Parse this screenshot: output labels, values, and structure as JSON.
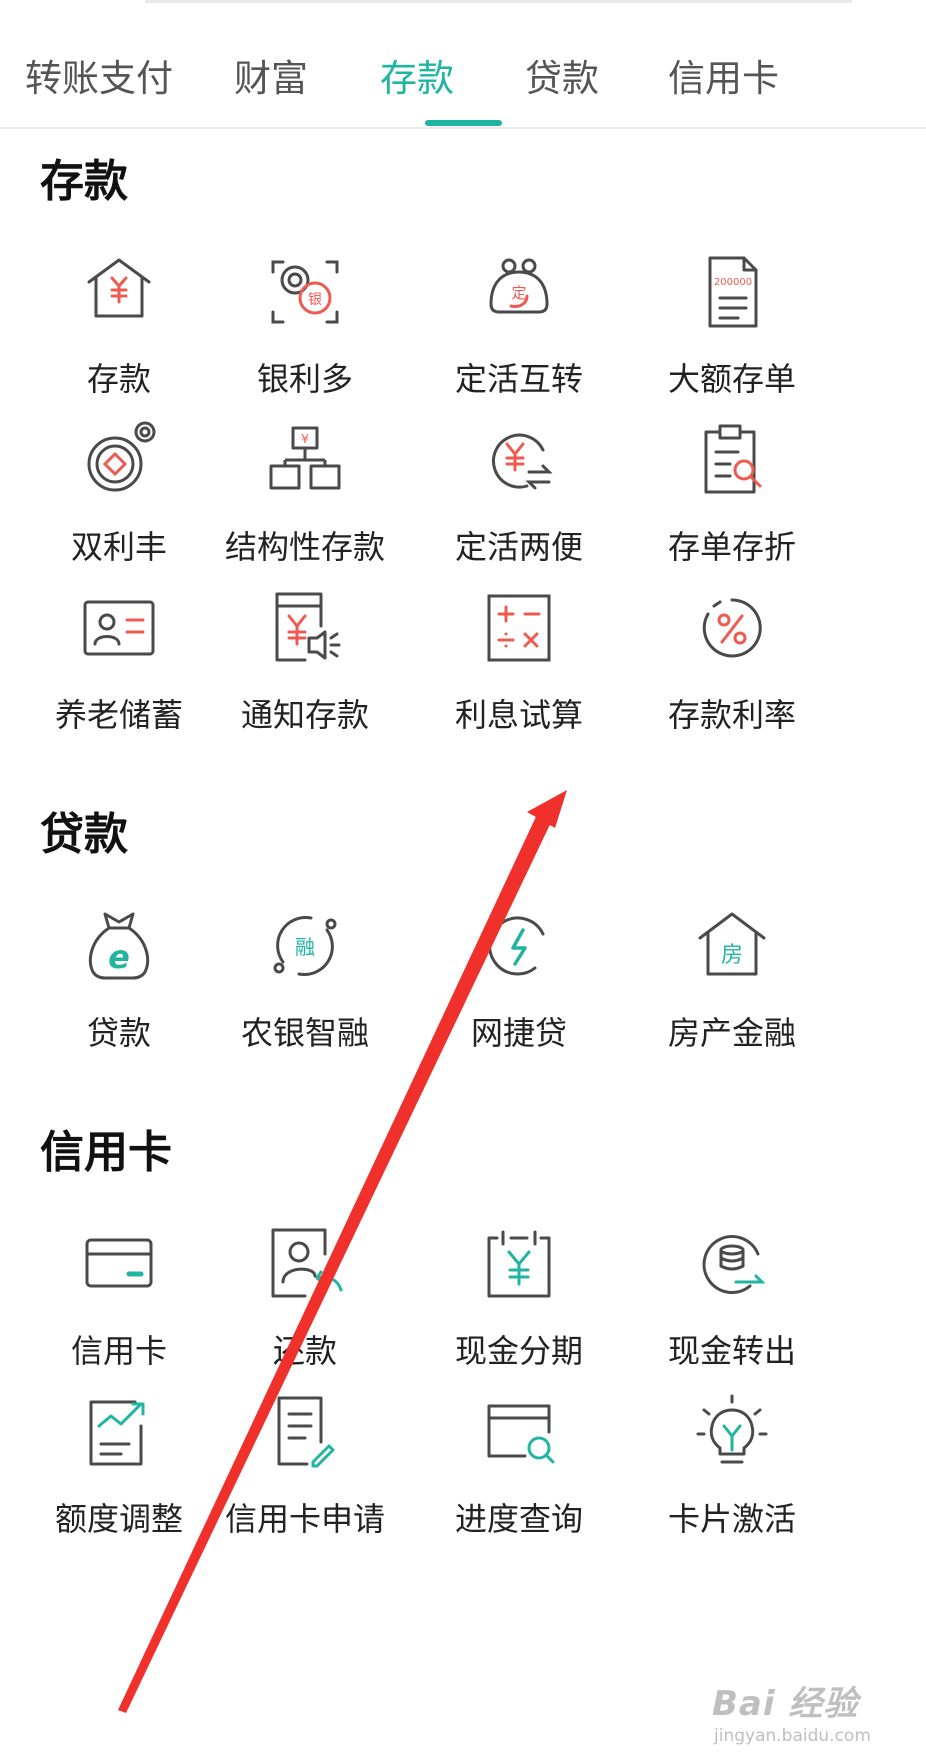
{
  "tabs": [
    {
      "label": "转账支付",
      "active": false
    },
    {
      "label": "财富",
      "active": false
    },
    {
      "label": "存款",
      "active": true
    },
    {
      "label": "贷款",
      "active": false
    },
    {
      "label": "信用卡",
      "active": false
    }
  ],
  "sections": {
    "deposit": {
      "title": "存款",
      "items": [
        {
          "label": "存款",
          "icon": "house-yuan-icon"
        },
        {
          "label": "银利多",
          "icon": "coins-scan-icon"
        },
        {
          "label": "定活互转",
          "icon": "coin-purse-icon"
        },
        {
          "label": "大额存单",
          "icon": "certificate-document-icon"
        },
        {
          "label": "双利丰",
          "icon": "double-coin-icon"
        },
        {
          "label": "结构性存款",
          "icon": "structure-blocks-icon"
        },
        {
          "label": "定活两便",
          "icon": "yuan-exchange-icon"
        },
        {
          "label": "存单存折",
          "icon": "clipboard-search-icon"
        },
        {
          "label": "养老储蓄",
          "icon": "person-card-icon"
        },
        {
          "label": "通知存款",
          "icon": "notice-speaker-icon"
        },
        {
          "label": "利息试算",
          "icon": "calculator-icon"
        },
        {
          "label": "存款利率",
          "icon": "percent-icon"
        }
      ]
    },
    "loan": {
      "title": "贷款",
      "items": [
        {
          "label": "贷款",
          "icon": "money-bag-icon"
        },
        {
          "label": "农银智融",
          "icon": "smart-finance-icon"
        },
        {
          "label": "网捷贷",
          "icon": "lightning-icon"
        },
        {
          "label": "房产金融",
          "icon": "house-icon"
        }
      ]
    },
    "credit": {
      "title": "信用卡",
      "items": [
        {
          "label": "信用卡",
          "icon": "credit-card-icon"
        },
        {
          "label": "还款",
          "icon": "repayment-icon"
        },
        {
          "label": "现金分期",
          "icon": "calendar-yuan-icon"
        },
        {
          "label": "现金转出",
          "icon": "coin-stack-icon"
        },
        {
          "label": "额度调整",
          "icon": "trend-chart-icon"
        },
        {
          "label": "信用卡申请",
          "icon": "application-form-icon"
        },
        {
          "label": "进度查询",
          "icon": "card-search-icon"
        },
        {
          "label": "卡片激活",
          "icon": "lightbulb-icon"
        }
      ]
    }
  },
  "watermark": {
    "brand": "Bai 经验",
    "url": "jingyan.baidu.com"
  },
  "colors": {
    "accent": "#1fb5a1",
    "icon_red": "#ee5a4f",
    "icon_gray": "#4a4a4a",
    "annotation_arrow": "#f0302a"
  }
}
